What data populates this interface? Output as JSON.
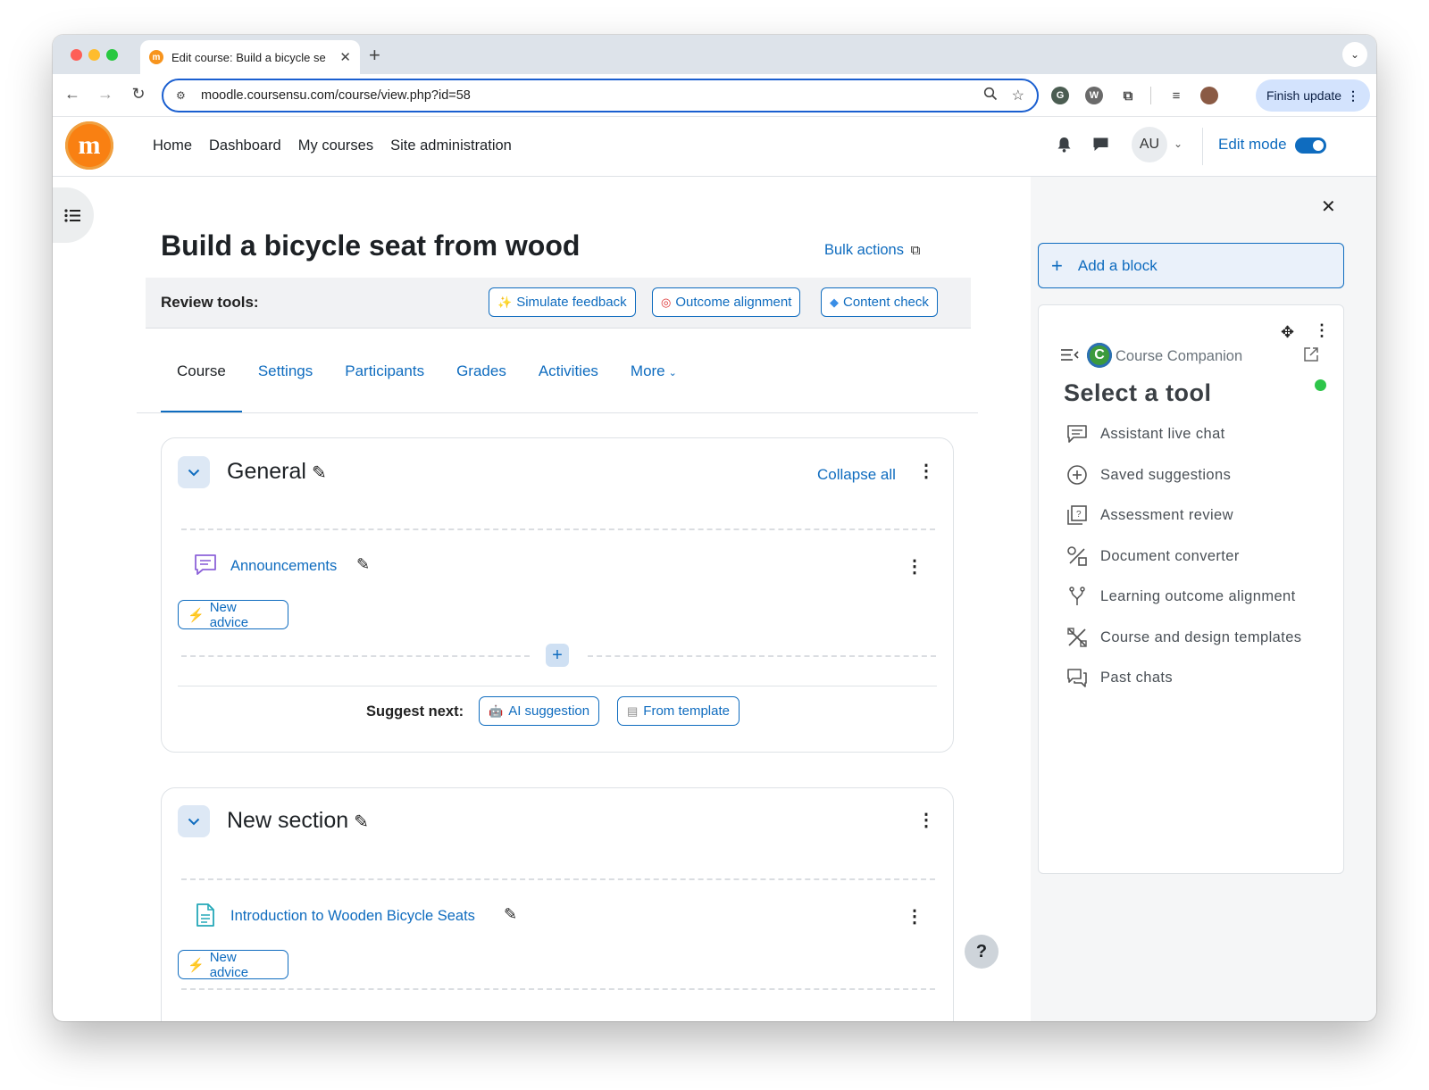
{
  "browser": {
    "tab_title": "Edit course: Build a bicycle se",
    "url": "moodle.coursensu.com/course/view.php?id=58",
    "finish_update": "Finish update",
    "profile_extension_letter": "W"
  },
  "header": {
    "nav": [
      "Home",
      "Dashboard",
      "My courses",
      "Site administration"
    ],
    "avatar_initials": "AU",
    "edit_mode_label": "Edit mode",
    "edit_mode_on": true
  },
  "course": {
    "title": "Build a bicycle seat from wood",
    "bulk_actions": "Bulk actions"
  },
  "review_tools": {
    "label": "Review tools:",
    "buttons": [
      "Simulate feedback",
      "Outcome alignment",
      "Content check"
    ]
  },
  "tabs": [
    "Course",
    "Settings",
    "Participants",
    "Grades",
    "Activities",
    "More"
  ],
  "sections": [
    {
      "title": "General",
      "collapse_all": "Collapse all",
      "activity": "Announcements",
      "advice": "New advice",
      "suggest_label": "Suggest next:",
      "suggest_buttons": [
        "AI suggestion",
        "From template"
      ]
    },
    {
      "title": "New section",
      "activity": "Introduction to Wooden Bicycle Seats",
      "advice": "New advice"
    }
  ],
  "drawer": {
    "add_block": "Add a block",
    "companion_name": "Course Companion",
    "companion_letter": "C",
    "select_title": "Select a tool",
    "tools": [
      {
        "label": "Assistant live chat",
        "icon": "chat-icon"
      },
      {
        "label": "Saved suggestions",
        "icon": "saved-suggestions-icon"
      },
      {
        "label": "Assessment review",
        "icon": "assessment-icon"
      },
      {
        "label": "Document converter",
        "icon": "document-converter-icon"
      },
      {
        "label": "Learning outcome alignment",
        "icon": "fork-icon"
      },
      {
        "label": "Course and design templates",
        "icon": "design-tools-icon"
      },
      {
        "label": "Past chats",
        "icon": "past-chats-icon"
      }
    ]
  },
  "help_label": "?",
  "colors": {
    "primary": "#0f6cbf",
    "logo_orange": "#f98012",
    "status_green": "#2ec54a"
  }
}
